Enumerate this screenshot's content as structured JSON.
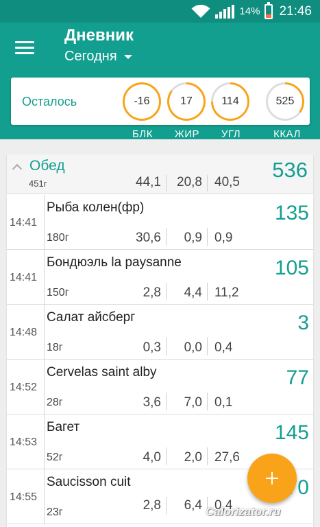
{
  "status": {
    "battery_pct": "14%",
    "time": "21:46"
  },
  "header": {
    "title": "Дневник",
    "date": "Сегодня"
  },
  "summary": {
    "label": "Осталось",
    "rings": [
      {
        "value": "-16",
        "label": "БЛК",
        "progress": 1.0
      },
      {
        "value": "17",
        "label": "ЖИР",
        "progress": 0.85
      },
      {
        "value": "114",
        "label": "УГЛ",
        "progress": 0.75
      },
      {
        "value": "525",
        "label": "ККАЛ",
        "progress": 0.35
      }
    ],
    "ring_color": "#f9a31a"
  },
  "meal": {
    "name": "Обед",
    "weight": "451г",
    "protein": "44,1",
    "fat": "20,8",
    "carbs": "40,5",
    "kcal": "536"
  },
  "entries": [
    {
      "time": "14:41",
      "name": "Рыба колен(фр)",
      "weight": "180г",
      "protein": "30,6",
      "fat": "0,9",
      "carbs": "0,9",
      "kcal": "135"
    },
    {
      "time": "14:41",
      "name": "Бондюэль la paysanne",
      "weight": "150г",
      "protein": "2,8",
      "fat": "4,4",
      "carbs": "11,2",
      "kcal": "105"
    },
    {
      "time": "14:48",
      "name": "Салат айсберг",
      "weight": "18г",
      "protein": "0,3",
      "fat": "0,0",
      "carbs": "0,4",
      "kcal": "3"
    },
    {
      "time": "14:52",
      "name": "Cervelas saint alby",
      "weight": "28г",
      "protein": "3,6",
      "fat": "7,0",
      "carbs": "0,1",
      "kcal": "77"
    },
    {
      "time": "14:53",
      "name": "Багет",
      "weight": "52г",
      "protein": "4,0",
      "fat": "2,0",
      "carbs": "27,6",
      "kcal": "145"
    },
    {
      "time": "14:55",
      "name": "Saucisson cuit",
      "weight": "23г",
      "protein": "2,8",
      "fat": "6,4",
      "carbs": "0,4",
      "kcal": "70"
    }
  ],
  "watermark": "Calorizator.ru",
  "colors": {
    "primary": "#139f8f",
    "status_bar": "#0f8d7f",
    "accent": "#f9a31a"
  }
}
